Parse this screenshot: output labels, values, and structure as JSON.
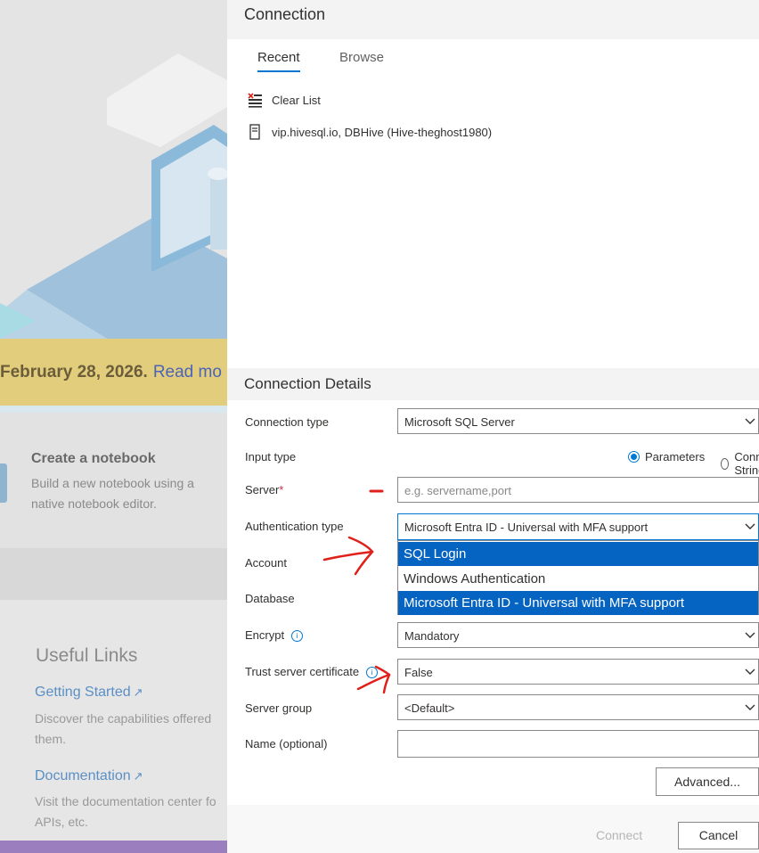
{
  "background": {
    "banner": {
      "text": "February 28, 2026.",
      "link": "Read mo"
    },
    "notebook": {
      "title": "Create a notebook",
      "description": "Build a new notebook using a native notebook editor."
    },
    "useful_links": {
      "title": "Useful Links",
      "items": [
        {
          "label": "Getting Started",
          "description": "Discover the capabilities offered",
          "description2": "them."
        },
        {
          "label": "Documentation",
          "description": "Visit the documentation center fo",
          "description2": "APIs, etc."
        }
      ]
    }
  },
  "dialog": {
    "title": "Connection",
    "tabs": [
      {
        "label": "Recent"
      },
      {
        "label": "Browse"
      }
    ],
    "recent": {
      "clear_label": "Clear List",
      "items": [
        {
          "label": "vip.hivesql.io, DBHive (Hive-theghost1980)"
        }
      ]
    },
    "details": {
      "title": "Connection Details",
      "fields": {
        "connection_type": {
          "label": "Connection type",
          "value": "Microsoft SQL Server"
        },
        "input_type": {
          "label": "Input type",
          "options": [
            "Parameters",
            "Connection String"
          ],
          "selected": "Parameters"
        },
        "server": {
          "label": "Server",
          "required_mark": "*",
          "placeholder": "e.g. servername,port"
        },
        "auth_type": {
          "label": "Authentication type",
          "value": "Microsoft Entra ID - Universal with MFA support",
          "options": [
            "SQL Login",
            "Windows Authentication",
            "Microsoft Entra ID - Universal with MFA support"
          ]
        },
        "account": {
          "label": "Account"
        },
        "database": {
          "label": "Database"
        },
        "encrypt": {
          "label": "Encrypt",
          "value": "Mandatory"
        },
        "trust_cert": {
          "label": "Trust server certificate",
          "value": "False"
        },
        "server_group": {
          "label": "Server group",
          "value": "<Default>"
        },
        "name": {
          "label": "Name (optional)",
          "value": ""
        }
      },
      "advanced_label": "Advanced..."
    },
    "footer": {
      "connect_label": "Connect",
      "cancel_label": "Cancel"
    }
  },
  "colors": {
    "accent": "#0078d4",
    "selection": "#0563c1",
    "annotation": "#e0201b",
    "banner": "#e2cd7c"
  }
}
